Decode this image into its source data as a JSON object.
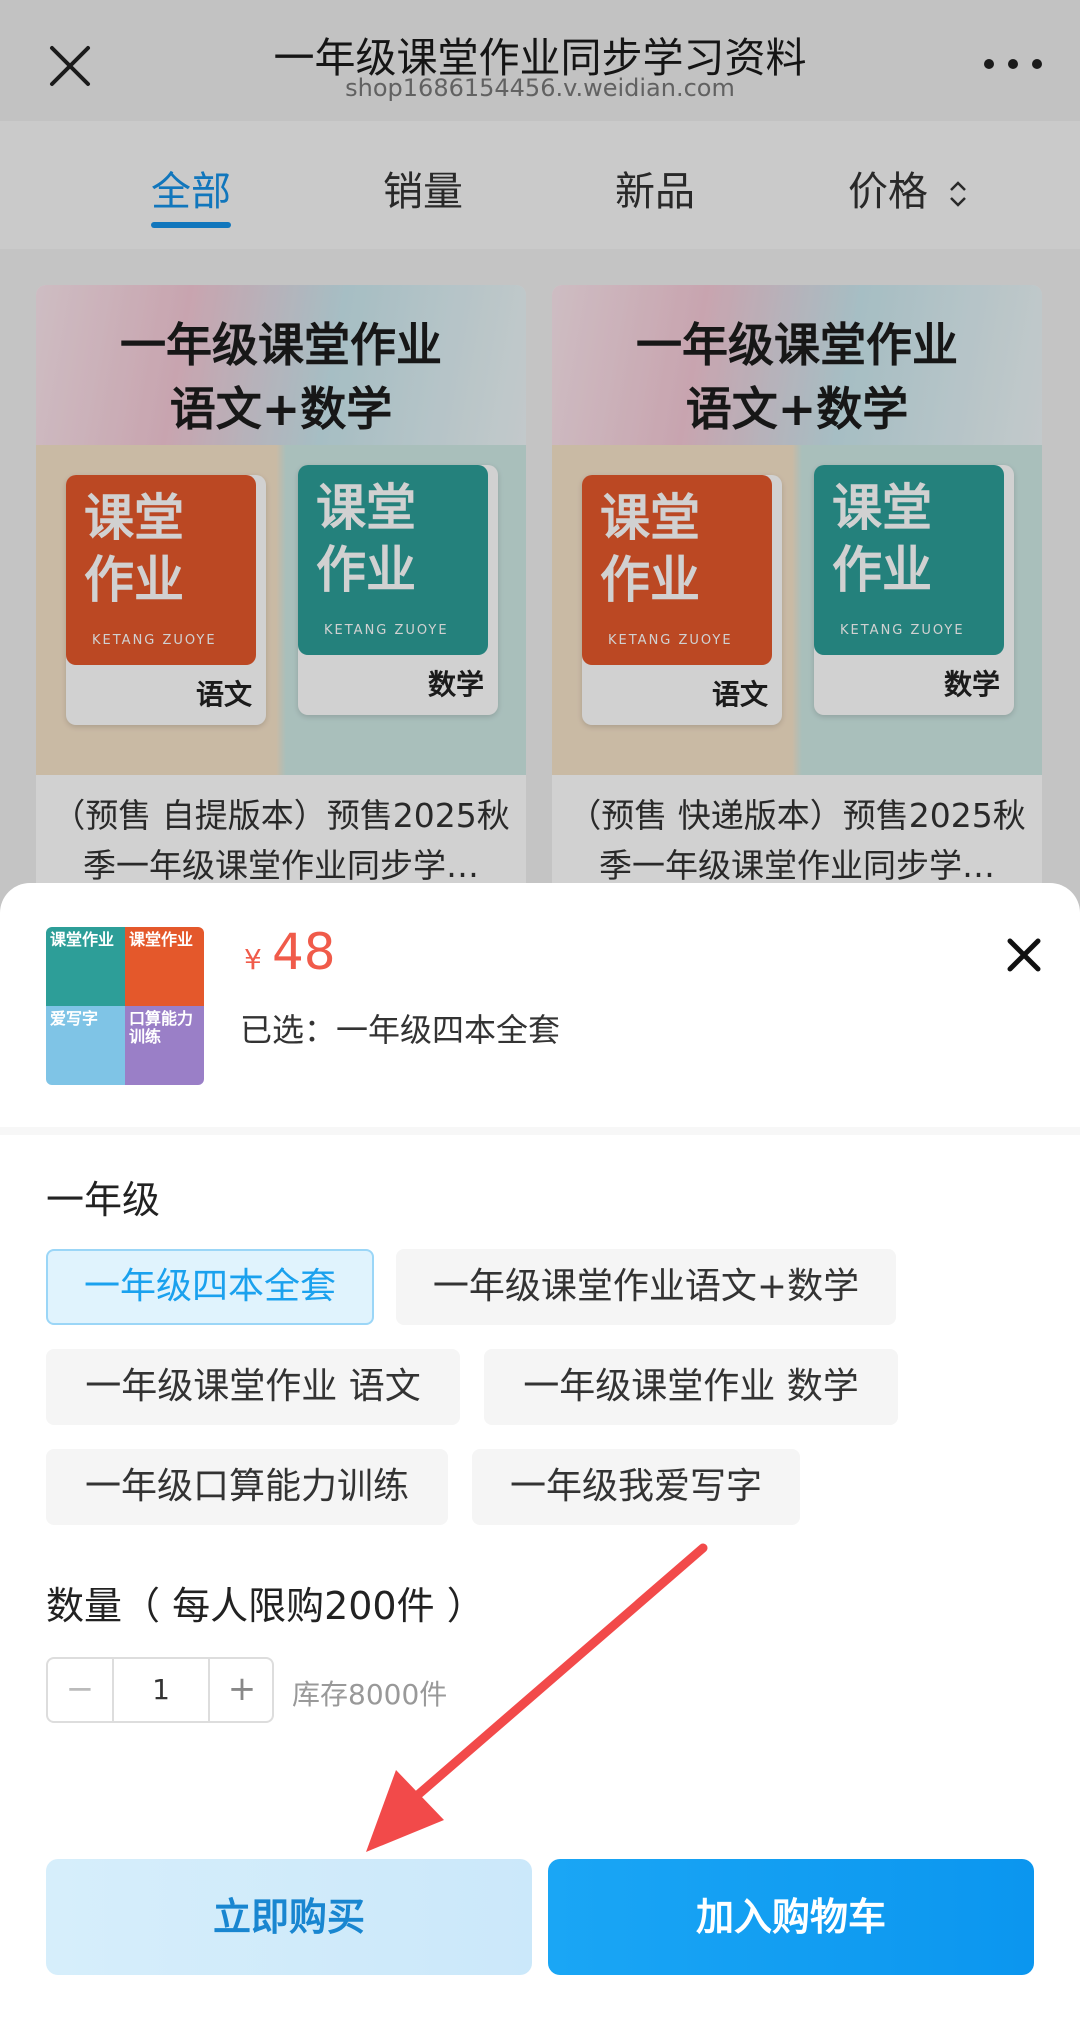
{
  "topbar": {
    "title": "一年级课堂作业同步学习资料",
    "subtitle": "shop1686154456.v.weidian.com",
    "close_icon": "close-icon",
    "more_icon": "more-dots-icon"
  },
  "tabs": [
    {
      "label": "全部",
      "active": true
    },
    {
      "label": "销量",
      "active": false
    },
    {
      "label": "新品",
      "active": false
    },
    {
      "label": "价格",
      "active": false
    }
  ],
  "products": [
    {
      "cover_line1": "一年级课堂作业",
      "cover_line2": "语文+数学",
      "book1_title": "课堂\n作业",
      "book1_subject": "语文",
      "book2_title": "课堂\n作业",
      "book2_subject": "数学",
      "latin": "KETANG ZUOYE",
      "name": "（预售 自提版本）预售2025秋季一年级课堂作业同步学…"
    },
    {
      "cover_line1": "一年级课堂作业",
      "cover_line2": "语文+数学",
      "book1_title": "课堂\n作业",
      "book1_subject": "语文",
      "book2_title": "课堂\n作业",
      "book2_subject": "数学",
      "latin": "KETANG ZUOYE",
      "name": "（预售 快递版本）预售2025秋季一年级课堂作业同步学…"
    }
  ],
  "sheet": {
    "currency": "¥",
    "price": "48",
    "selected_text": "已选：一年级四本全套",
    "thumb_labels": [
      "课堂作业",
      "课堂作业",
      "爱写字",
      "口算能力训练"
    ],
    "spec_group": "一年级",
    "options": [
      {
        "label": "一年级四本全套",
        "selected": true
      },
      {
        "label": "一年级课堂作业语文+数学",
        "selected": false
      },
      {
        "label": "一年级课堂作业 语文",
        "selected": false
      },
      {
        "label": "一年级课堂作业 数学",
        "selected": false
      },
      {
        "label": "一年级口算能力训练",
        "selected": false
      },
      {
        "label": "一年级我爱写字",
        "selected": false
      }
    ],
    "quantity_label": "数量（ 每人限购200件 ）",
    "quantity": "1",
    "minus": "−",
    "plus": "+",
    "stock_text": "库存8000件",
    "buy_now": "立即购买",
    "add_to_cart": "加入购物车"
  },
  "colors": {
    "accent": "#1590e6",
    "price": "#f05b4a",
    "cart_button": "#0b96ef",
    "annotation_arrow": "#f24a4a"
  }
}
